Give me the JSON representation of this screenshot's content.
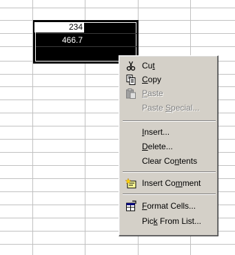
{
  "cells": [
    {
      "value": "234"
    },
    {
      "value": "466.7"
    }
  ],
  "context_menu": {
    "items": [
      {
        "id": "cut",
        "pre": "Cu",
        "key": "t",
        "post": "",
        "icon": "scissors-icon",
        "enabled": true
      },
      {
        "id": "copy",
        "pre": "",
        "key": "C",
        "post": "opy",
        "icon": "copy-icon",
        "enabled": true
      },
      {
        "id": "paste",
        "pre": "",
        "key": "P",
        "post": "aste",
        "icon": "paste-icon",
        "enabled": false
      },
      {
        "id": "paste-special",
        "pre": "Paste ",
        "key": "S",
        "post": "pecial...",
        "icon": "",
        "enabled": false
      },
      {
        "id": "insert",
        "pre": "",
        "key": "I",
        "post": "nsert...",
        "icon": "",
        "enabled": true
      },
      {
        "id": "delete",
        "pre": "",
        "key": "D",
        "post": "elete...",
        "icon": "",
        "enabled": true
      },
      {
        "id": "clear-contents",
        "pre": "Clear Co",
        "key": "n",
        "post": "tents",
        "icon": "",
        "enabled": true
      },
      {
        "id": "insert-comment",
        "pre": "Insert Co",
        "key": "m",
        "post": "ment",
        "icon": "comment-icon",
        "enabled": true
      },
      {
        "id": "format-cells",
        "pre": "",
        "key": "F",
        "post": "ormat Cells...",
        "icon": "format-cells-icon",
        "enabled": true
      },
      {
        "id": "pick-from-list",
        "pre": "Pic",
        "key": "k",
        "post": " From List...",
        "icon": "",
        "enabled": true
      }
    ]
  }
}
